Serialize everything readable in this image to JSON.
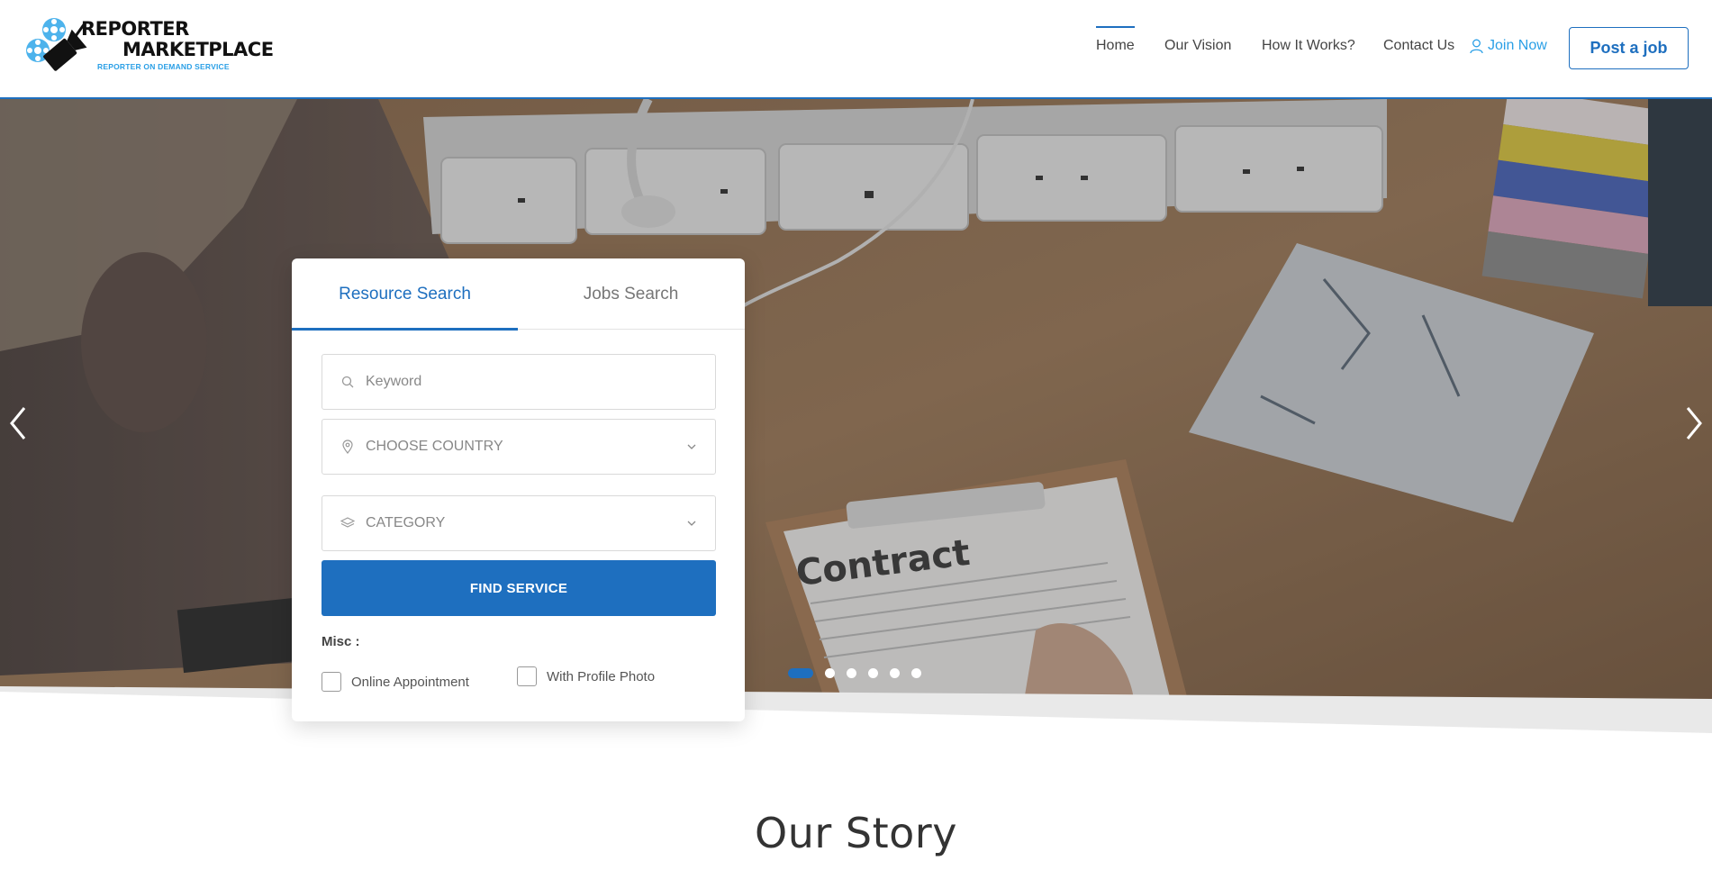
{
  "logo": {
    "line1": "REPORTER",
    "line2": "MARKETPLACE",
    "tagline": "REPORTER ON DEMAND SERVICE"
  },
  "nav": {
    "items": [
      {
        "label": "Home",
        "active": true
      },
      {
        "label": "Our Vision"
      },
      {
        "label": "How It Works?"
      },
      {
        "label": "Contact Us"
      }
    ],
    "join_label": "Join Now",
    "post_job_label": "Post a job"
  },
  "search": {
    "tabs": [
      {
        "label": "Resource Search",
        "active": true
      },
      {
        "label": "Jobs Search"
      }
    ],
    "keyword_placeholder": "Keyword",
    "country_placeholder": "CHOOSE COUNTRY",
    "category_placeholder": "CATEGORY",
    "find_label": "FIND SERVICE",
    "misc_label": "Misc :",
    "checkboxes": [
      {
        "label": "Online Appointment",
        "checked": false
      },
      {
        "label": "With Profile Photo",
        "checked": false
      }
    ]
  },
  "hero": {
    "contract_text": "Contract",
    "slides_total": 6,
    "slide_active": 1
  },
  "story": {
    "title": "Our Story"
  },
  "colors": {
    "accent": "#1e6fbf",
    "join": "#2a9fe6"
  }
}
